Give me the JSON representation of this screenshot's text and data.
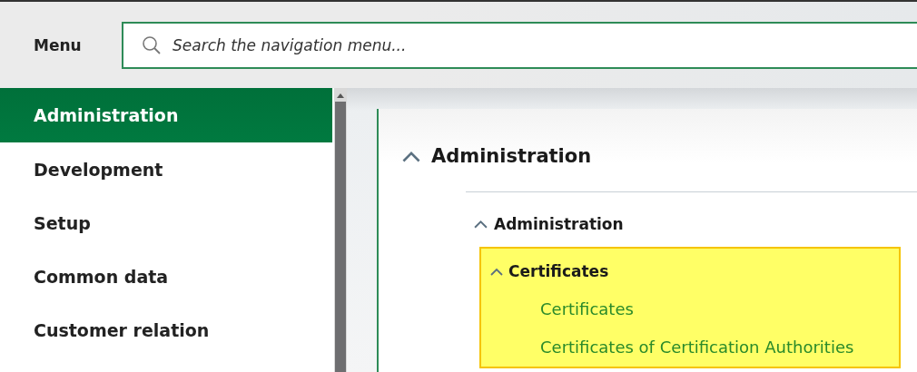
{
  "header": {
    "title": "Menu"
  },
  "search": {
    "placeholder": "Search the navigation menu..."
  },
  "sidebar": {
    "items": [
      {
        "label": "Administration",
        "selected": true
      },
      {
        "label": "Development",
        "selected": false
      },
      {
        "label": "Setup",
        "selected": false
      },
      {
        "label": "Common data",
        "selected": false
      },
      {
        "label": "Customer relation",
        "selected": false
      }
    ]
  },
  "content": {
    "tree": [
      {
        "kind": "group",
        "title": "Administration",
        "expanded": true,
        "highlighted": false,
        "children": [
          {
            "kind": "group",
            "title": "Administration",
            "expanded": true,
            "highlighted": false,
            "children": [
              {
                "kind": "group",
                "title": "Certificates",
                "expanded": true,
                "highlighted": true,
                "children": [
                  {
                    "kind": "link",
                    "title": "Certificates"
                  },
                  {
                    "kind": "link",
                    "title": "Certificates of Certification Authorities"
                  }
                ]
              }
            ]
          }
        ]
      }
    ]
  }
}
